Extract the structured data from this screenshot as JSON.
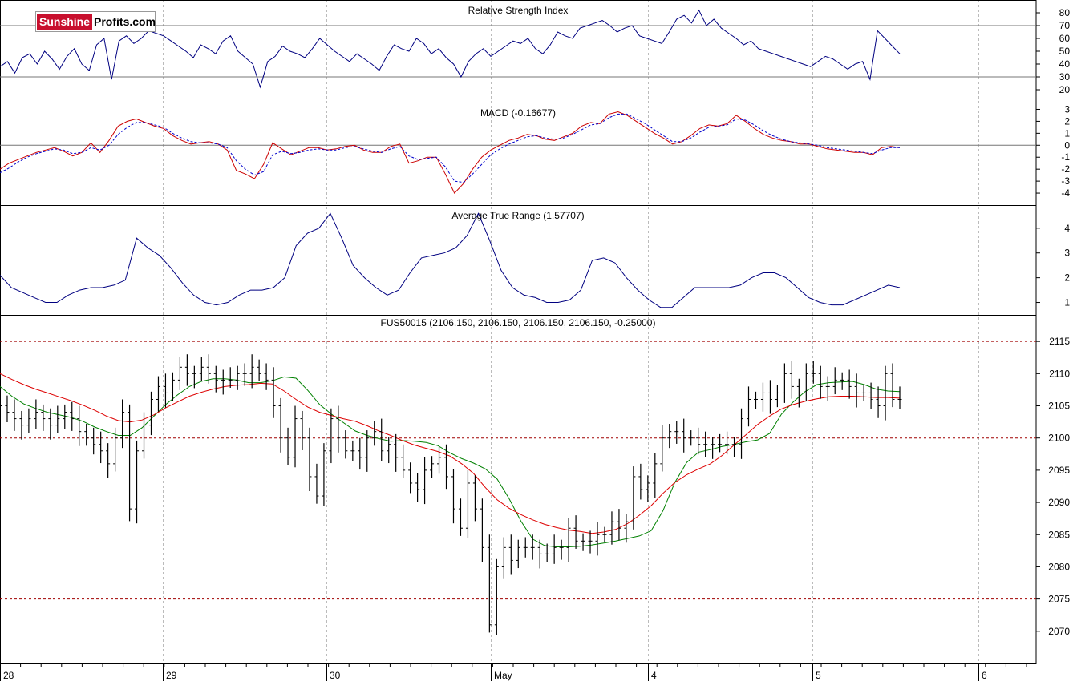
{
  "brand": {
    "part1": "Sunshine",
    "part2": "Profits.com"
  },
  "chart_data": [
    {
      "type": "line",
      "panel": "rsi",
      "title": "Relative Strength Index",
      "ylim": [
        10,
        90
      ],
      "yticks": [
        20,
        30,
        40,
        50,
        60,
        70,
        80
      ],
      "reference_lines": [
        30,
        70
      ],
      "series": [
        {
          "color": "#000080",
          "values": [
            38,
            42,
            33,
            45,
            48,
            40,
            50,
            44,
            36,
            46,
            52,
            40,
            35,
            55,
            60,
            28,
            58,
            62,
            56,
            60,
            66,
            64,
            62,
            58,
            54,
            50,
            45,
            55,
            52,
            48,
            58,
            62,
            50,
            45,
            40,
            22,
            42,
            46,
            54,
            50,
            48,
            45,
            52,
            60,
            55,
            50,
            46,
            42,
            48,
            44,
            40,
            35,
            46,
            55,
            52,
            50,
            60,
            56,
            48,
            52,
            45,
            40,
            30,
            42,
            48,
            52,
            46,
            50,
            54,
            58,
            56,
            60,
            52,
            48,
            55,
            65,
            62,
            60,
            68,
            70,
            72,
            74,
            70,
            65,
            68,
            70,
            62,
            60,
            58,
            56,
            65,
            75,
            78,
            72,
            82,
            70,
            75,
            68,
            64,
            60,
            55,
            58,
            52,
            50,
            48,
            46,
            44,
            42,
            40,
            38,
            42,
            46,
            44,
            40,
            36,
            40,
            42,
            28,
            66,
            60,
            54,
            48
          ]
        }
      ]
    },
    {
      "type": "line",
      "panel": "macd",
      "title": "MACD (-0.16677)",
      "ylim": [
        -5,
        3.5
      ],
      "yticks": [
        -4,
        -3,
        -2,
        -1,
        0,
        1,
        2,
        3
      ],
      "reference_lines": [
        0
      ],
      "series": [
        {
          "name": "MACD",
          "color": "#cc0000",
          "values": [
            -2.0,
            -1.5,
            -1.2,
            -0.9,
            -0.6,
            -0.4,
            -0.2,
            -0.5,
            -0.9,
            -0.6,
            0.2,
            -0.6,
            0.4,
            1.6,
            2.0,
            2.2,
            1.9,
            1.6,
            1.4,
            0.8,
            0.4,
            0.1,
            0.2,
            0.3,
            0.1,
            -0.4,
            -2.1,
            -2.4,
            -2.8,
            -1.6,
            0.2,
            -0.3,
            -0.8,
            -0.5,
            -0.2,
            -0.2,
            -0.4,
            -0.3,
            -0.1,
            0.0,
            -0.4,
            -0.6,
            -0.6,
            -0.1,
            0.1,
            -1.5,
            -1.3,
            -1.0,
            -1.0,
            -2.4,
            -4.0,
            -3.2,
            -2.0,
            -1.0,
            -0.4,
            0.0,
            0.4,
            0.6,
            0.9,
            0.8,
            0.5,
            0.4,
            0.7,
            1.0,
            1.6,
            1.9,
            1.8,
            2.6,
            2.8,
            2.5,
            2.0,
            1.5,
            1.0,
            0.6,
            0.1,
            0.3,
            0.8,
            1.4,
            1.7,
            1.6,
            1.8,
            2.5,
            2.0,
            1.4,
            0.9,
            0.6,
            0.4,
            0.3,
            0.1,
            0.1,
            -0.1,
            -0.3,
            -0.4,
            -0.5,
            -0.6,
            -0.6,
            -0.8,
            -0.2,
            -0.1,
            -0.2
          ]
        },
        {
          "name": "Signal",
          "color": "#0000cc",
          "dashed": true,
          "values": [
            -2.3,
            -1.9,
            -1.4,
            -1.0,
            -0.7,
            -0.5,
            -0.3,
            -0.4,
            -0.7,
            -0.6,
            -0.2,
            -0.4,
            0.0,
            0.9,
            1.5,
            1.9,
            1.9,
            1.7,
            1.5,
            1.0,
            0.6,
            0.3,
            0.2,
            0.2,
            0.1,
            -0.2,
            -1.3,
            -2.0,
            -2.5,
            -2.2,
            -0.8,
            -0.5,
            -0.7,
            -0.6,
            -0.4,
            -0.3,
            -0.4,
            -0.4,
            -0.2,
            -0.1,
            -0.3,
            -0.5,
            -0.6,
            -0.3,
            -0.1,
            -0.9,
            -1.2,
            -1.1,
            -1.0,
            -1.8,
            -3.0,
            -3.1,
            -2.4,
            -1.6,
            -0.8,
            -0.3,
            0.1,
            0.4,
            0.7,
            0.8,
            0.6,
            0.5,
            0.6,
            0.9,
            1.3,
            1.7,
            1.8,
            2.3,
            2.6,
            2.6,
            2.2,
            1.8,
            1.3,
            0.8,
            0.3,
            0.3,
            0.6,
            1.1,
            1.5,
            1.6,
            1.7,
            2.2,
            2.1,
            1.7,
            1.2,
            0.8,
            0.5,
            0.3,
            0.2,
            0.1,
            0.0,
            -0.2,
            -0.3,
            -0.4,
            -0.5,
            -0.6,
            -0.7,
            -0.4,
            -0.2,
            -0.2
          ]
        }
      ]
    },
    {
      "type": "line",
      "panel": "atr",
      "title": "Average True Range (1.57707)",
      "ylim": [
        0.5,
        4.9
      ],
      "yticks": [
        1,
        2,
        3,
        4
      ],
      "series": [
        {
          "color": "#000080",
          "values": [
            2.1,
            1.6,
            1.4,
            1.2,
            1.0,
            1.0,
            1.3,
            1.5,
            1.6,
            1.6,
            1.7,
            1.9,
            3.6,
            3.2,
            2.9,
            2.4,
            1.8,
            1.3,
            1.0,
            0.9,
            1.0,
            1.3,
            1.5,
            1.5,
            1.6,
            2.0,
            3.3,
            3.8,
            4.0,
            4.6,
            3.6,
            2.5,
            2.0,
            1.6,
            1.3,
            1.5,
            2.2,
            2.8,
            2.9,
            3.0,
            3.2,
            3.7,
            4.6,
            3.5,
            2.3,
            1.6,
            1.3,
            1.2,
            1.0,
            1.0,
            1.1,
            1.5,
            2.7,
            2.8,
            2.6,
            2.0,
            1.5,
            1.1,
            0.8,
            0.8,
            1.2,
            1.6,
            1.6,
            1.6,
            1.6,
            1.7,
            2.0,
            2.2,
            2.2,
            2.0,
            1.6,
            1.2,
            1.0,
            0.9,
            0.9,
            1.1,
            1.3,
            1.5,
            1.7,
            1.6
          ]
        }
      ]
    },
    {
      "type": "candlestick",
      "panel": "price",
      "title": "FUS50015 (2106.150, 2106.150, 2106.150, 2106.150, -0.25000)",
      "ylim": [
        2065,
        2119
      ],
      "yticks": [
        2070,
        2075,
        2080,
        2085,
        2090,
        2095,
        2100,
        2105,
        2110,
        2115
      ],
      "reference_lines": [
        2075,
        2100,
        2115
      ],
      "close": [
        2105,
        2104,
        2103,
        2102,
        2103,
        2104,
        2103,
        2102,
        2103,
        2104,
        2103,
        2101,
        2100,
        2099,
        2098,
        2096,
        2100,
        2104,
        2089,
        2098,
        2102,
        2106,
        2108,
        2107,
        2109,
        2111,
        2110,
        2110,
        2111,
        2110,
        2109,
        2109,
        2109,
        2110,
        2110,
        2111,
        2110,
        2109,
        2105,
        2100,
        2097,
        2103,
        2100,
        2094,
        2091,
        2098,
        2103,
        2100,
        2098,
        2098,
        2097,
        2100,
        2101,
        2098,
        2099,
        2097,
        2095,
        2093,
        2092,
        2095,
        2096,
        2097,
        2094,
        2089,
        2086,
        2093,
        2089,
        2083,
        2071,
        2080,
        2083,
        2081,
        2083,
        2083,
        2083,
        2082,
        2082,
        2083,
        2083,
        2086,
        2084,
        2084,
        2084,
        2085,
        2085,
        2087,
        2086,
        2087,
        2094,
        2092,
        2093,
        2096,
        2100,
        2101,
        2101,
        2100,
        2100,
        2099,
        2099,
        2099,
        2099,
        2099,
        2099,
        2103,
        2106,
        2106,
        2107,
        2106,
        2107,
        2110,
        2108,
        2107,
        2110,
        2110,
        2108,
        2108,
        2109,
        2109,
        2108,
        2107,
        2107,
        2106,
        2105,
        2110,
        2106,
        2106
      ],
      "series": [
        {
          "name": "MA fast",
          "color": "#008000",
          "values": [
            2108,
            2106.5,
            2105.3,
            2104.6,
            2104.0,
            2103.6,
            2103.2,
            2102.6,
            2101.7,
            2101.0,
            2100.4,
            2100.4,
            2101.6,
            2103.4,
            2105.2,
            2106.7,
            2108.0,
            2108.8,
            2109.2,
            2109.2,
            2109.0,
            2108.6,
            2108.6,
            2108.9,
            2109.5,
            2109.3,
            2107.4,
            2105.2,
            2103.7,
            2102.4,
            2101.1,
            2100.4,
            2099.9,
            2099.5,
            2099.6,
            2099.5,
            2099.3,
            2098.8,
            2097.7,
            2096.8,
            2096.1,
            2095.2,
            2093.6,
            2090.6,
            2087.1,
            2084.3,
            2083.3,
            2083.1,
            2083.1,
            2083.2,
            2083.4,
            2083.7,
            2084.0,
            2084.4,
            2084.8,
            2085.6,
            2088.7,
            2093.1,
            2096.2,
            2097.8,
            2098.2,
            2098.7,
            2099.0,
            2099.4,
            2099.7,
            2100.7,
            2103.7,
            2105.6,
            2107.2,
            2108.3,
            2108.6,
            2108.7,
            2108.8,
            2108.3,
            2107.6,
            2107.3,
            2107.2
          ]
        },
        {
          "name": "MA slow",
          "color": "#dd0000",
          "values": [
            2110,
            2109.1,
            2108.3,
            2107.6,
            2107.0,
            2106.4,
            2105.8,
            2105.1,
            2104.3,
            2103.4,
            2102.7,
            2102.5,
            2102.8,
            2103.6,
            2104.7,
            2105.6,
            2106.5,
            2107.1,
            2107.6,
            2108.0,
            2108.2,
            2108.3,
            2108.5,
            2108.4,
            2107.3,
            2106.0,
            2104.8,
            2104.0,
            2103.5,
            2103.0,
            2102.6,
            2101.9,
            2101.1,
            2100.4,
            2099.6,
            2098.9,
            2098.4,
            2097.9,
            2097.2,
            2096.0,
            2094.5,
            2092.3,
            2090.4,
            2089.1,
            2088.1,
            2087.3,
            2086.6,
            2086.1,
            2085.7,
            2085.5,
            2085.2,
            2085.4,
            2085.8,
            2086.7,
            2088.0,
            2089.5,
            2091.4,
            2093.1,
            2094.3,
            2095.2,
            2096.0,
            2097.3,
            2098.9,
            2100.5,
            2102.1,
            2103.4,
            2104.5,
            2105.2,
            2105.7,
            2106.1,
            2106.4,
            2106.5,
            2106.5,
            2106.4,
            2106.3,
            2106.3,
            2106.2
          ]
        }
      ]
    }
  ],
  "x_axis": {
    "labels": [
      "28",
      "29",
      "30",
      "May",
      "4",
      "5",
      "6"
    ]
  }
}
